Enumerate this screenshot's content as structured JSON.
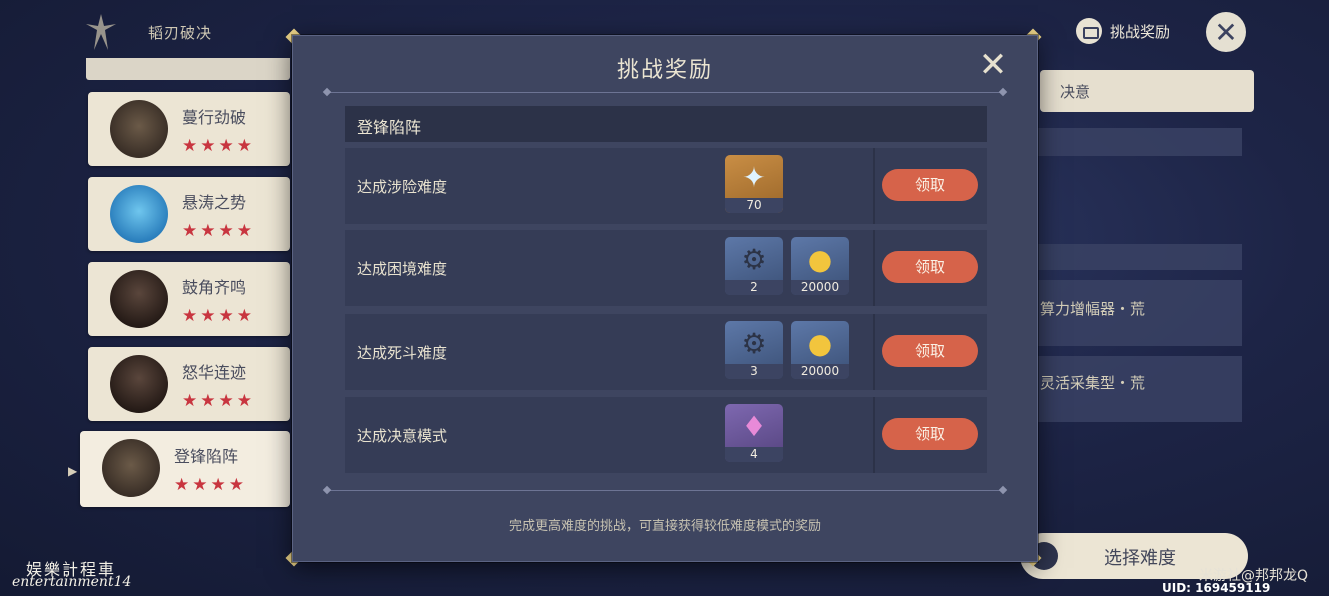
{
  "topbar": {
    "title": "韬刃破决",
    "reward_button_label": "挑战奖励",
    "reward_badge": "!"
  },
  "stages": [
    {
      "name": "蔓行劲破",
      "stars": "★★★★",
      "portrait": "brown"
    },
    {
      "name": "悬涛之势",
      "stars": "★★★★",
      "portrait": "blue"
    },
    {
      "name": "鼓角齐鸣",
      "stars": "★★★★",
      "portrait": "dark"
    },
    {
      "name": "怒华连迹",
      "stars": "★★★★",
      "portrait": "dark"
    },
    {
      "name": "登锋陷阵",
      "stars": "★★★★",
      "portrait": "brown",
      "selected": true
    }
  ],
  "right_panel": {
    "tab_label": "决意",
    "line_1": "算力增幅器・荒",
    "line_2": "灵活采集型・荒",
    "choose_difficulty": "选择难度"
  },
  "modal": {
    "title": "挑战奖励",
    "section_title": "登锋陷阵",
    "rows": [
      {
        "label": "达成涉险难度",
        "claim": "领取",
        "items": [
          {
            "icon": "primogem-icon",
            "qty": "70",
            "color": "gold"
          }
        ]
      },
      {
        "label": "达成困境难度",
        "claim": "领取",
        "items": [
          {
            "icon": "material-icon",
            "qty": "2",
            "color": "blue"
          },
          {
            "icon": "mora-icon",
            "qty": "20000",
            "color": "blue"
          }
        ]
      },
      {
        "label": "达成死斗难度",
        "claim": "领取",
        "items": [
          {
            "icon": "material-icon",
            "qty": "3",
            "color": "blue"
          },
          {
            "icon": "mora-icon",
            "qty": "20000",
            "color": "blue"
          }
        ]
      },
      {
        "label": "达成决意模式",
        "claim": "领取",
        "items": [
          {
            "icon": "crystal-icon",
            "qty": "4",
            "color": "purple"
          }
        ]
      }
    ],
    "footnote": "完成更高难度的挑战，可直接获得较低难度模式的奖励"
  },
  "overlay": {
    "watermark_line1": "娱樂計程車",
    "watermark_line2": "entertainment14",
    "credit": "米游社@邦邦龙Q",
    "uid": "UID: 169459119"
  },
  "colors": {
    "claim_button": "#d6634a",
    "star": "#c8353f",
    "modal_bg": "#3e4560"
  }
}
